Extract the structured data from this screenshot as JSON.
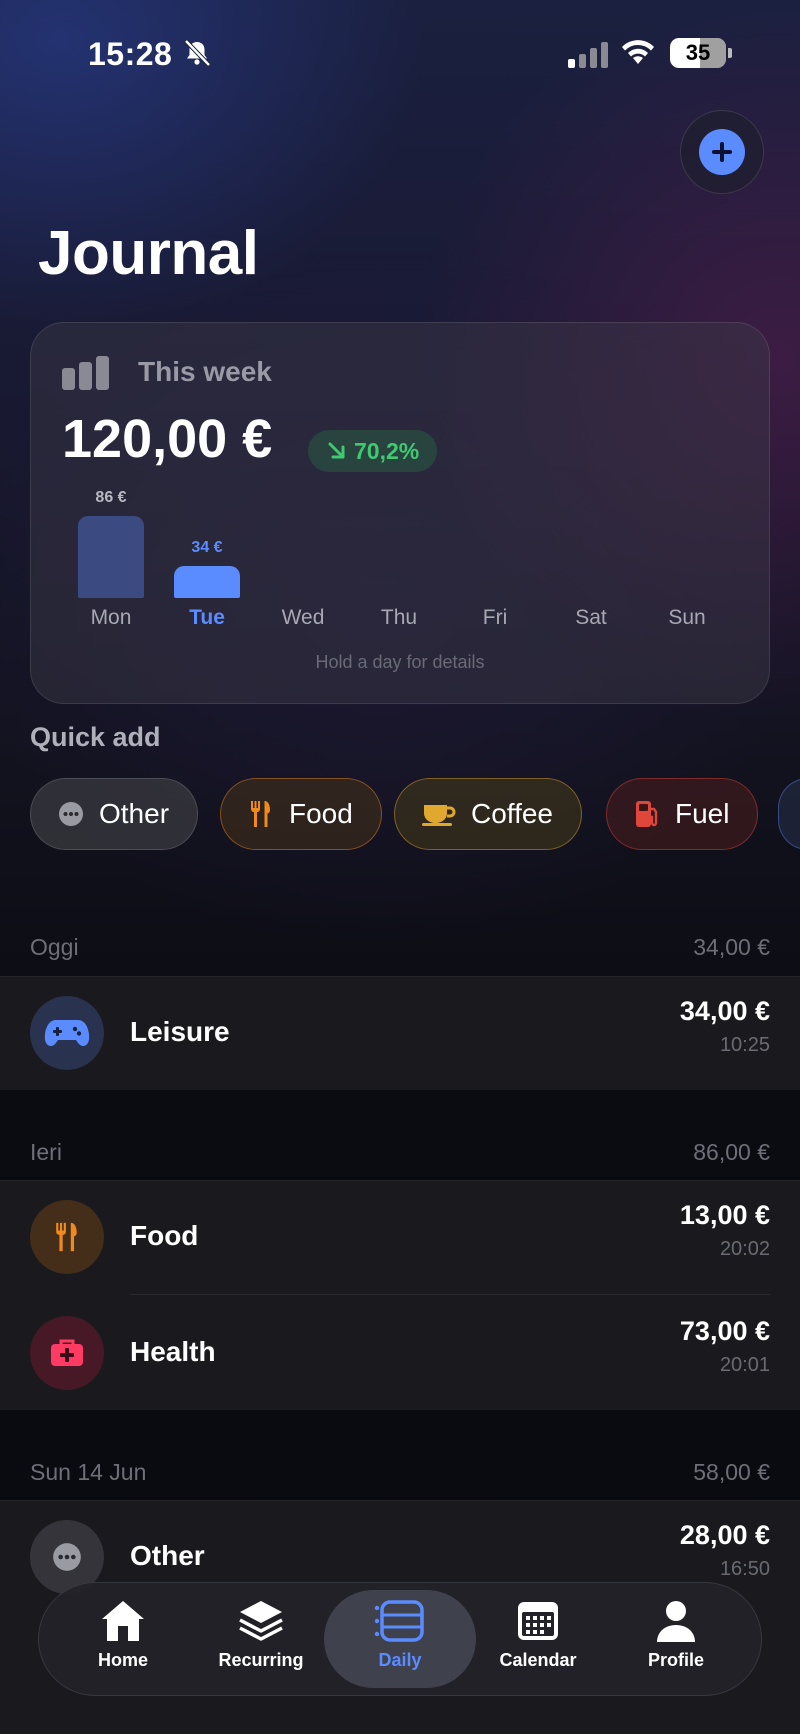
{
  "status_bar": {
    "time": "15:28",
    "battery": "35"
  },
  "header": {
    "title": "Journal"
  },
  "week": {
    "label": "This week",
    "total": "120,00 €",
    "delta": "70,2%",
    "hint": "Hold a day for details",
    "days": [
      "Mon",
      "Tue",
      "Wed",
      "Thu",
      "Fri",
      "Sat",
      "Sun"
    ],
    "bar_labels": [
      "86 €",
      "34 €"
    ],
    "selected_day": "Tue"
  },
  "chart_data": {
    "type": "bar",
    "categories": [
      "Mon",
      "Tue",
      "Wed",
      "Thu",
      "Fri",
      "Sat",
      "Sun"
    ],
    "values": [
      86,
      34,
      0,
      0,
      0,
      0,
      0
    ],
    "title": "",
    "xlabel": "",
    "ylabel": ""
  },
  "quick_add": {
    "title": "Quick add",
    "chips": [
      {
        "label": "Other",
        "icon": "more-icon"
      },
      {
        "label": "Food",
        "icon": "fork-knife-icon"
      },
      {
        "label": "Coffee",
        "icon": "coffee-cup-icon"
      },
      {
        "label": "Fuel",
        "icon": "fuel-pump-icon"
      }
    ]
  },
  "sections": [
    {
      "title": "Oggi",
      "total": "34,00 €",
      "items": [
        {
          "name": "Leisure",
          "amount": "34,00 €",
          "time": "10:25",
          "icon": "gamepad-icon"
        }
      ]
    },
    {
      "title": "Ieri",
      "total": "86,00 €",
      "items": [
        {
          "name": "Food",
          "amount": "13,00 €",
          "time": "20:02",
          "icon": "fork-knife-icon"
        },
        {
          "name": "Health",
          "amount": "73,00 €",
          "time": "20:01",
          "icon": "medical-kit-icon"
        }
      ]
    },
    {
      "title": "Sun 14 Jun",
      "total": "58,00 €",
      "items": [
        {
          "name": "Other",
          "amount": "28,00 €",
          "time": "16:50",
          "icon": "more-icon"
        }
      ]
    }
  ],
  "tabs": [
    {
      "label": "Home",
      "icon": "home-icon"
    },
    {
      "label": "Recurring",
      "icon": "layers-icon"
    },
    {
      "label": "Daily",
      "icon": "list-icon"
    },
    {
      "label": "Calendar",
      "icon": "calendar-icon"
    },
    {
      "label": "Profile",
      "icon": "person-icon"
    }
  ],
  "colors": {
    "accent": "#5b8cff",
    "positive": "#3fc971",
    "food": "#f08a1c",
    "coffee": "#e0a82e",
    "fuel": "#e0463a",
    "health": "#ff3b63",
    "leisure": "#5b8cff"
  }
}
